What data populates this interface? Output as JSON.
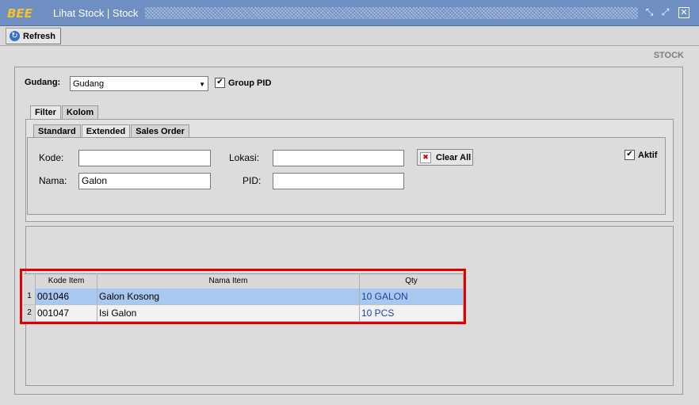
{
  "window": {
    "logo": "BEE",
    "title": "Lihat Stock | Stock",
    "restore_icon": "restore-icon",
    "maximize_icon": "maximize-icon",
    "close_icon": "close-icon"
  },
  "toolbar": {
    "refresh_label": "Refresh"
  },
  "header": {
    "section_label": "STOCK"
  },
  "filter": {
    "gudang_label": "Gudang:",
    "gudang_value": "Gudang",
    "group_pid_label": "Group PID",
    "group_pid_checked": true
  },
  "tabs_outer": [
    {
      "label": "Filter"
    },
    {
      "label": "Kolom"
    }
  ],
  "tabs_inner": [
    {
      "label": "Standard"
    },
    {
      "label": "Extended"
    },
    {
      "label": "Sales Order"
    }
  ],
  "form": {
    "kode_label": "Kode:",
    "kode_value": "",
    "nama_label": "Nama:",
    "nama_value": "Galon",
    "lokasi_label": "Lokasi:",
    "lokasi_value": "",
    "pid_label": "PID:",
    "pid_value": "",
    "clear_all_label": "Clear All",
    "aktif_label": "Aktif",
    "aktif_checked": true
  },
  "table": {
    "columns": [
      "Kode Item",
      "Nama Item",
      "Qty"
    ],
    "rows": [
      {
        "num": "1",
        "kode": "001046",
        "nama": "Galon Kosong",
        "qty": "10 GALON"
      },
      {
        "num": "2",
        "kode": "001047",
        "nama": "Isi Galon",
        "qty": "10 PCS"
      }
    ]
  },
  "colors": {
    "title_bar": "#6f8fc3",
    "highlight": "#e00000",
    "selected_row": "#a9c8ef",
    "qty_text": "#1f3fa8"
  }
}
